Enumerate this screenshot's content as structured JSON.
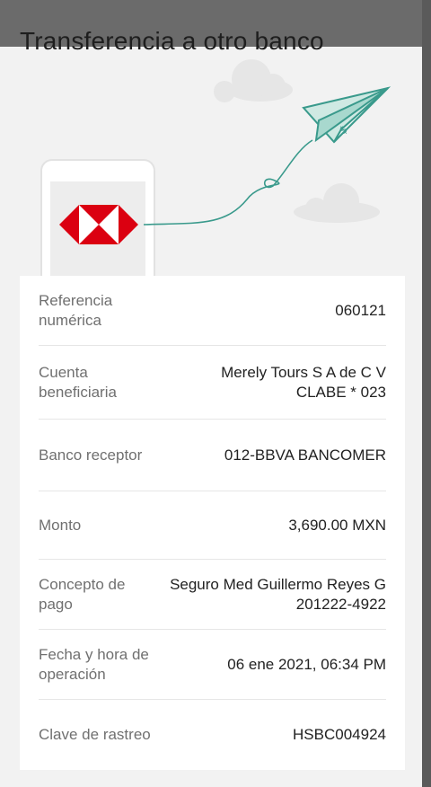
{
  "header": {
    "title": "Transferencia a otro banco"
  },
  "illustration": {
    "phone_logo": "hsbc-hexagon-logo",
    "plane_icon": "paper-airplane-money-icon",
    "clouds": "cloud-icon"
  },
  "details": [
    {
      "label": "Referencia numérica",
      "value_lines": [
        "060121"
      ]
    },
    {
      "label": "Cuenta beneficiaria",
      "value_lines": [
        "Merely Tours S A de C V",
        "CLABE * 023"
      ]
    },
    {
      "label": "Banco receptor",
      "value_lines": [
        "012-BBVA BANCOMER"
      ]
    },
    {
      "label": "Monto",
      "value_lines": [
        "3,690.00 MXN"
      ]
    },
    {
      "label": "Concepto de pago",
      "value_lines": [
        "Seguro Med Guillermo Reyes G",
        "201222-4922"
      ]
    },
    {
      "label": "Fecha y hora de operación",
      "value_lines": [
        "06 ene 2021, 06:34 PM"
      ]
    },
    {
      "label": "Clave de rastreo",
      "value_lines": [
        "HSBC004924"
      ]
    }
  ],
  "colors": {
    "hsbc_red": "#db0011",
    "plane_teal": "#3a9a8c",
    "plane_fill": "#bfe3dc"
  }
}
